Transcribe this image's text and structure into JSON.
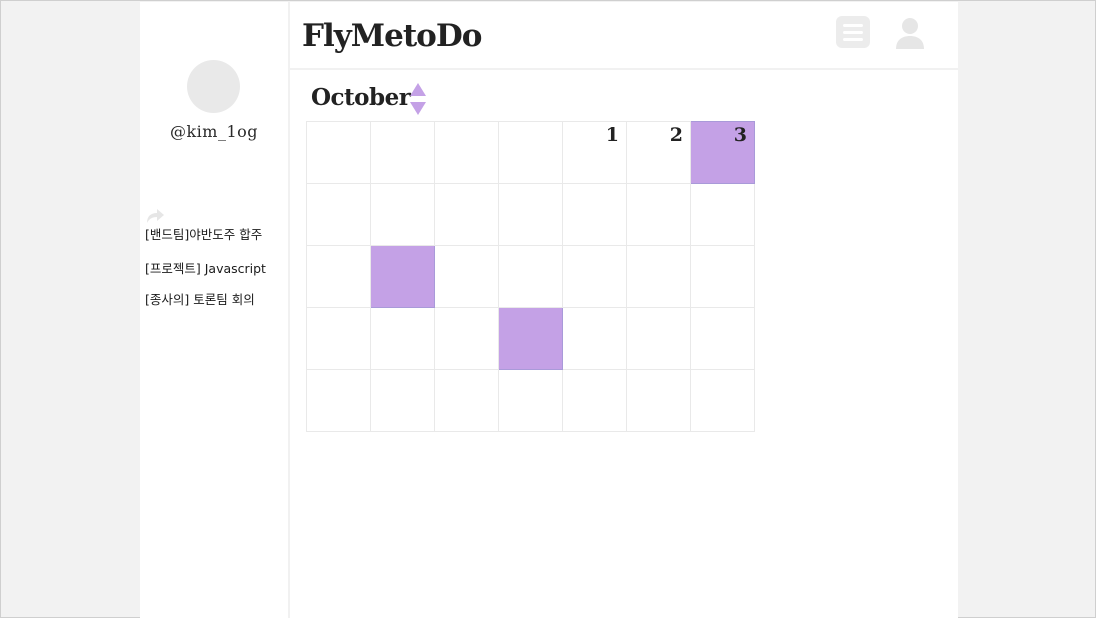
{
  "app": {
    "title": "FlyMetoDo"
  },
  "profile": {
    "username": "@kim_1og"
  },
  "icons": {
    "share": "share-icon",
    "menu": "menu-icon",
    "user": "user-icon",
    "month_prev": "triangle-up-icon",
    "month_next": "triangle-down-icon"
  },
  "tasks": [
    {
      "label": "[밴드팀]야반도주 합주"
    },
    {
      "label": "[프로젝트] Javascript"
    },
    {
      "label": "[종사의] 토론팀 회의"
    }
  ],
  "calendar": {
    "month": "October",
    "highlight_color": "#c4a1e6",
    "weeks": [
      [
        {
          "day": "",
          "marked": false
        },
        {
          "day": "",
          "marked": false
        },
        {
          "day": "",
          "marked": false
        },
        {
          "day": "",
          "marked": false
        },
        {
          "day": "1",
          "marked": false
        },
        {
          "day": "2",
          "marked": false
        },
        {
          "day": "3",
          "marked": true
        }
      ],
      [
        {
          "day": "",
          "marked": false
        },
        {
          "day": "",
          "marked": false
        },
        {
          "day": "",
          "marked": false
        },
        {
          "day": "",
          "marked": false
        },
        {
          "day": "",
          "marked": false
        },
        {
          "day": "",
          "marked": false
        },
        {
          "day": "",
          "marked": false
        }
      ],
      [
        {
          "day": "",
          "marked": false
        },
        {
          "day": "",
          "marked": true
        },
        {
          "day": "",
          "marked": false
        },
        {
          "day": "",
          "marked": false
        },
        {
          "day": "",
          "marked": false
        },
        {
          "day": "",
          "marked": false
        },
        {
          "day": "",
          "marked": false
        }
      ],
      [
        {
          "day": "",
          "marked": false
        },
        {
          "day": "",
          "marked": false
        },
        {
          "day": "",
          "marked": false
        },
        {
          "day": "",
          "marked": true
        },
        {
          "day": "",
          "marked": false
        },
        {
          "day": "",
          "marked": false
        },
        {
          "day": "",
          "marked": false
        }
      ],
      [
        {
          "day": "",
          "marked": false
        },
        {
          "day": "",
          "marked": false
        },
        {
          "day": "",
          "marked": false
        },
        {
          "day": "",
          "marked": false
        },
        {
          "day": "",
          "marked": false
        },
        {
          "day": "",
          "marked": false
        },
        {
          "day": "",
          "marked": false
        }
      ]
    ]
  }
}
